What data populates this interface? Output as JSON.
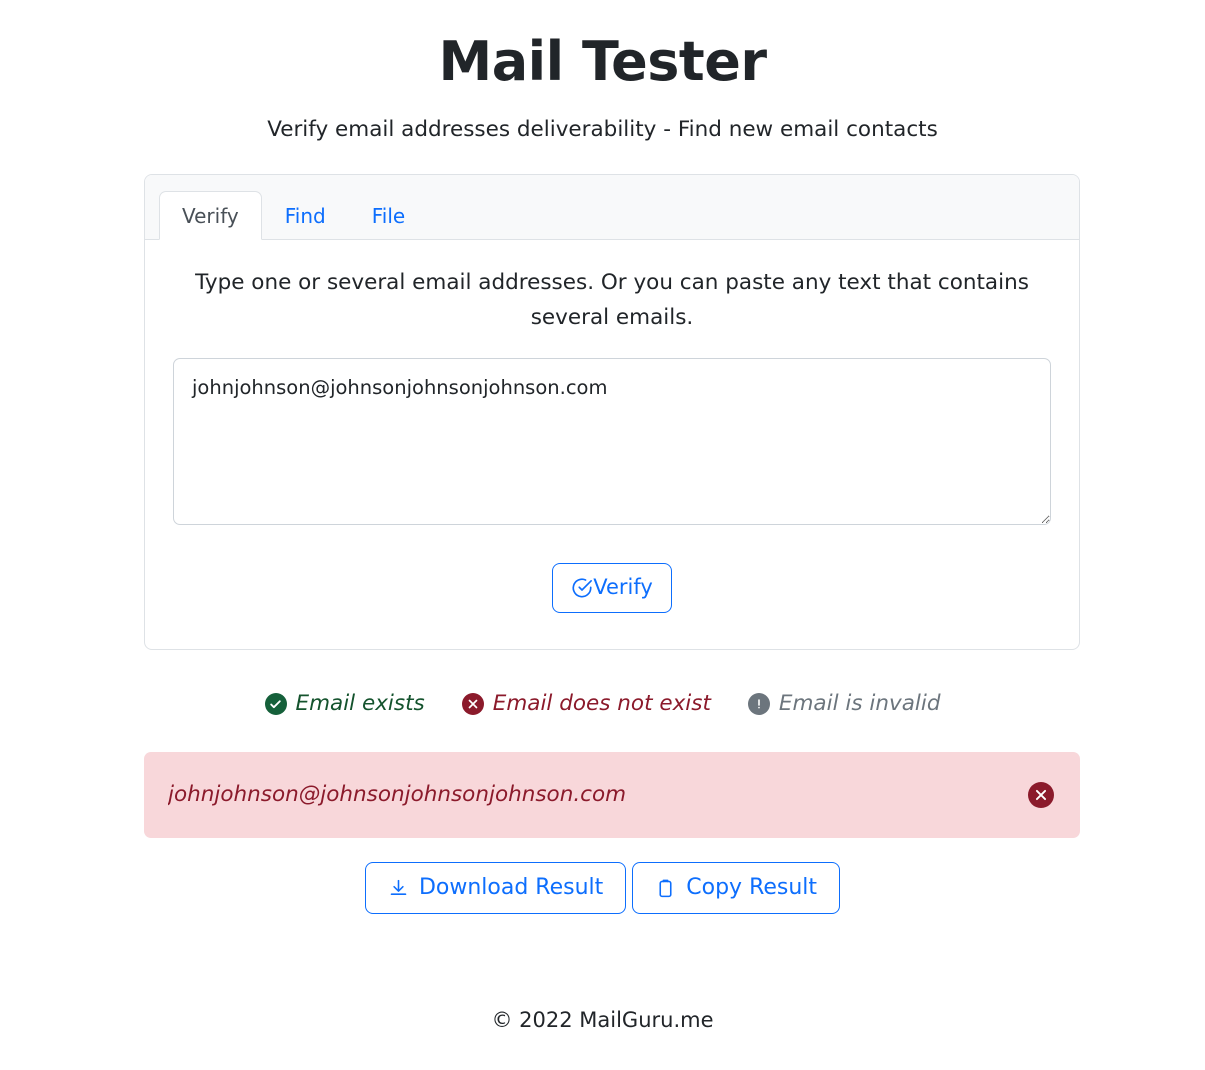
{
  "header": {
    "title": "Mail Tester",
    "subtitle": "Verify email addresses deliverability - Find new email contacts"
  },
  "card": {
    "tabs": [
      {
        "label": "Verify",
        "active": true
      },
      {
        "label": "Find",
        "active": false
      },
      {
        "label": "File",
        "active": false
      }
    ],
    "instructions": "Type one or several email addresses. Or you can paste any text that contains several emails.",
    "email_input": {
      "value": "johnjohnson@johnsonjohnsonjohnson.com",
      "placeholder": ""
    },
    "verify_button": {
      "label": "Verify",
      "icon": "circle-check-icon"
    }
  },
  "legend": [
    {
      "label": "Email exists",
      "icon": "check-circle-icon",
      "color": "#15603a"
    },
    {
      "label": "Email does not exist",
      "icon": "x-circle-icon",
      "color": "#8b1a2b"
    },
    {
      "label": "Email is invalid",
      "icon": "exclamation-circle-icon",
      "color": "#6c757d"
    }
  ],
  "results": [
    {
      "email": "johnjohnson@johnsonjohnsonjohnson.com",
      "status": "does-not-exist",
      "status_icon": "x-circle-icon",
      "background": "#f8d7da",
      "text_color": "#8b1a2b"
    }
  ],
  "actions": [
    {
      "label": "Download Result",
      "icon": "download-icon"
    },
    {
      "label": "Copy Result",
      "icon": "clipboard-icon"
    }
  ],
  "footer": {
    "copyright": "© 2022 MailGuru.me"
  },
  "colors": {
    "link": "#0d6efd",
    "text": "#212529",
    "border": "#dee2e6",
    "tab_strip": "#f8f9fa",
    "danger_bg": "#f8d7da",
    "danger": "#8b1a2b",
    "success": "#15603a",
    "muted": "#6c757d"
  }
}
